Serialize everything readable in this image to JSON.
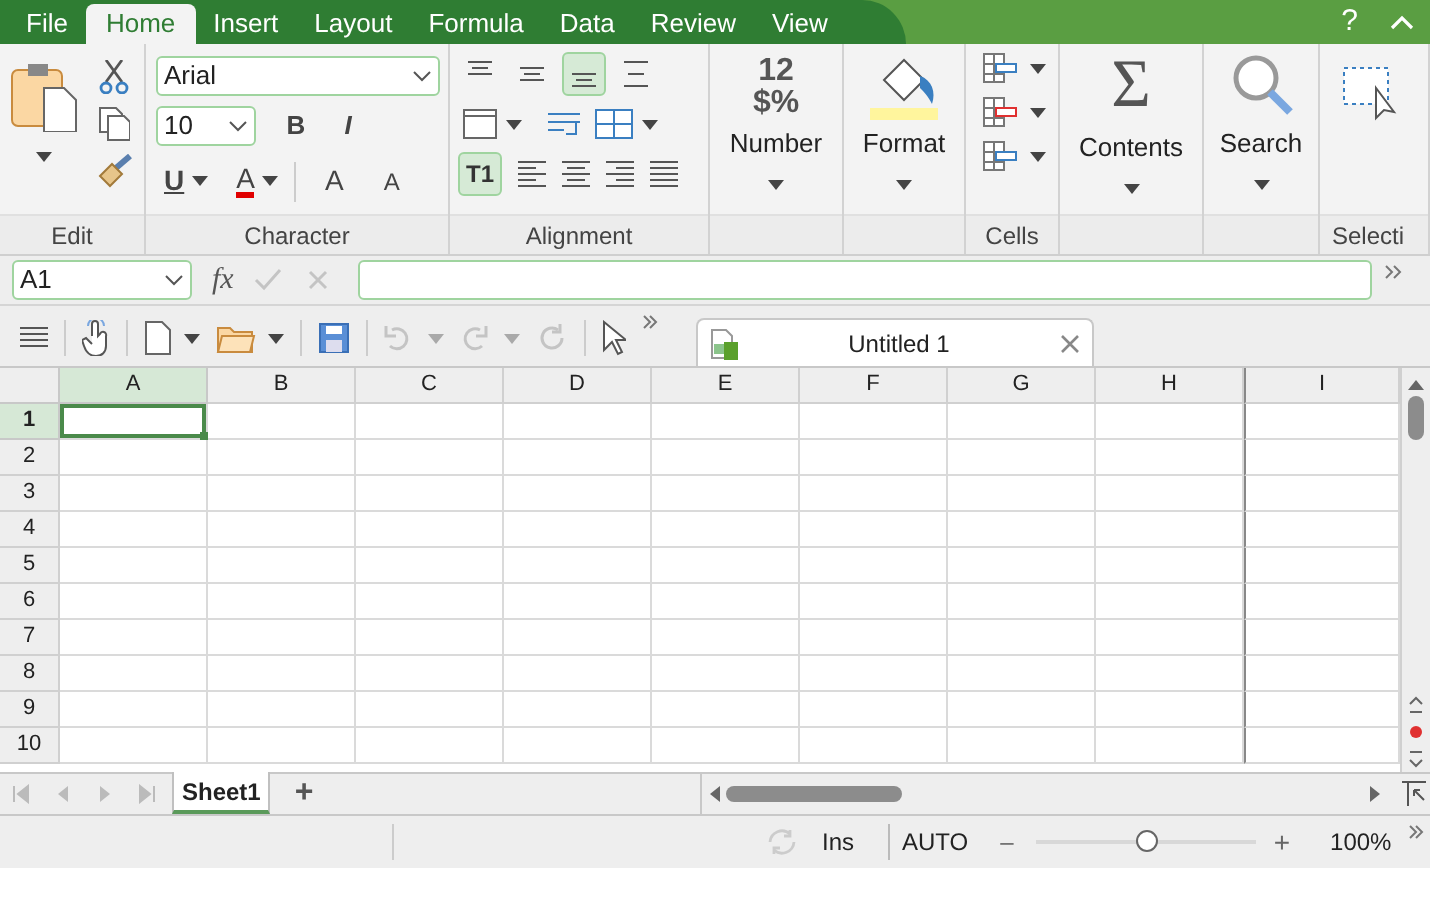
{
  "menu": {
    "tabs": [
      {
        "label": "File",
        "selected": false
      },
      {
        "label": "Home",
        "selected": true
      },
      {
        "label": "Insert",
        "selected": false
      },
      {
        "label": "Layout",
        "selected": false
      },
      {
        "label": "Formula",
        "selected": false
      },
      {
        "label": "Data",
        "selected": false
      },
      {
        "label": "Review",
        "selected": false
      },
      {
        "label": "View",
        "selected": false
      }
    ],
    "help": "?"
  },
  "ribbon": {
    "groups": [
      {
        "kind": "edit",
        "label": "Edit"
      },
      {
        "kind": "character",
        "label": "Character",
        "font": "Arial",
        "size": "10",
        "bold": "B",
        "italic": "I",
        "underline": "U",
        "font_color": "A",
        "grow": "A",
        "shrink": "A"
      },
      {
        "kind": "alignment",
        "label": "Alignment",
        "vertical_align": [
          {
            "selected": false
          },
          {
            "selected": false
          },
          {
            "selected": true
          },
          {
            "selected": false
          }
        ],
        "text_direction": {
          "label": "T1",
          "selected": true
        }
      },
      {
        "kind": "number",
        "button_label": "Number",
        "icon_text": [
          "12",
          "$%"
        ]
      },
      {
        "kind": "format",
        "button_label": "Format"
      },
      {
        "kind": "cells",
        "label": "Cells"
      },
      {
        "kind": "contents",
        "button_label": "Contents",
        "icon_text": "Σ"
      },
      {
        "kind": "search",
        "button_label": "Search"
      },
      {
        "kind": "selection",
        "label": "Selecti"
      }
    ]
  },
  "formula_bar": {
    "name_box": "A1",
    "fx": "fx"
  },
  "document_tab": {
    "title": "Untitled 1"
  },
  "sheet": {
    "columns": [
      {
        "label": "A",
        "selected": true
      },
      {
        "label": "B",
        "selected": false
      },
      {
        "label": "C",
        "selected": false
      },
      {
        "label": "D",
        "selected": false
      },
      {
        "label": "E",
        "selected": false
      },
      {
        "label": "F",
        "selected": false
      },
      {
        "label": "G",
        "selected": false
      },
      {
        "label": "H",
        "selected": false
      },
      {
        "label": "I",
        "selected": false
      }
    ],
    "rows": [
      {
        "label": "1",
        "selected": true
      },
      {
        "label": "2",
        "selected": false
      },
      {
        "label": "3",
        "selected": false
      },
      {
        "label": "4",
        "selected": false
      },
      {
        "label": "5",
        "selected": false
      },
      {
        "label": "6",
        "selected": false
      },
      {
        "label": "7",
        "selected": false
      },
      {
        "label": "8",
        "selected": false
      },
      {
        "label": "9",
        "selected": false
      },
      {
        "label": "10",
        "selected": false
      }
    ]
  },
  "sheet_tabs": {
    "tabs": [
      {
        "label": "Sheet1",
        "selected": true
      }
    ],
    "add": "+"
  },
  "status_bar": {
    "insert_mode": "Ins",
    "calc_mode": "AUTO",
    "zoom_out": "–",
    "zoom_in": "+",
    "zoom": "100%",
    "zoom_slider": {
      "level": 0.5
    }
  }
}
